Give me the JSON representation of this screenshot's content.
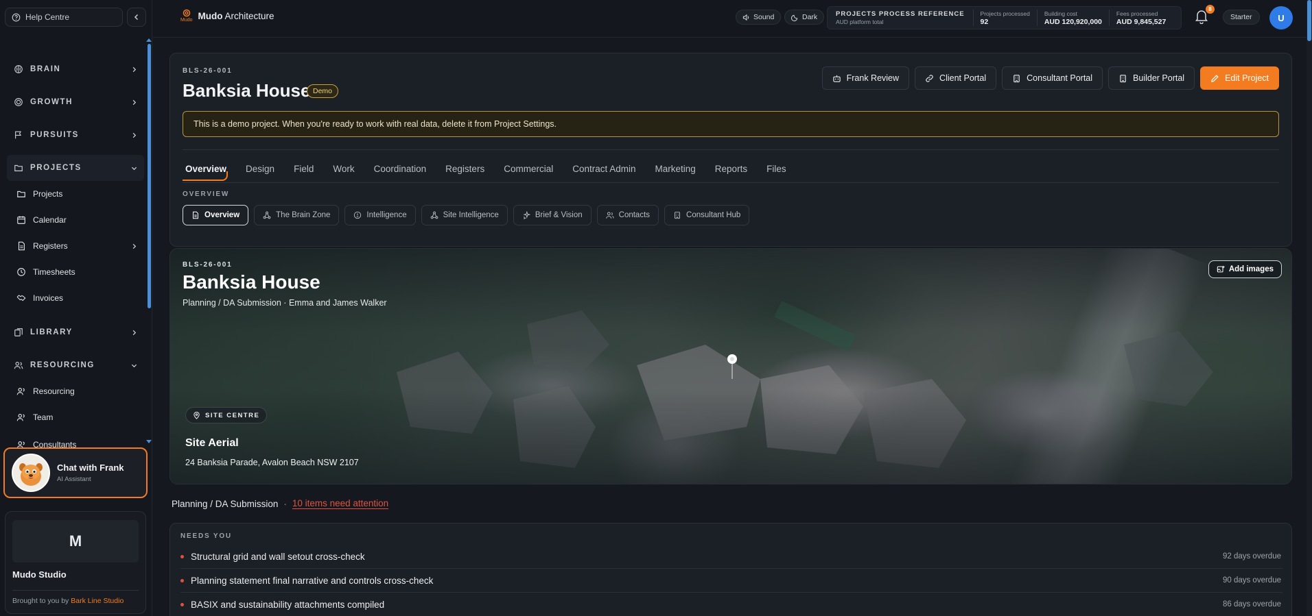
{
  "sidebar": {
    "help_label": "Help Centre",
    "sections": {
      "brain": "BRAIN",
      "growth": "GROWTH",
      "pursuits": "PURSUITS",
      "projects": "PROJECTS",
      "library": "LIBRARY",
      "resourcing": "RESOURCING"
    },
    "projects_items": [
      "Projects",
      "Calendar",
      "Registers",
      "Timesheets",
      "Invoices"
    ],
    "resourcing_items": [
      "Resourcing",
      "Team",
      "Consultants"
    ],
    "chat": {
      "title": "Chat with Frank",
      "subtitle": "AI Assistant"
    },
    "studio": {
      "logo_letter": "M",
      "name": "Mudo Studio",
      "credit_prefix": "Brought to you by",
      "credit_link": "Bark Line Studio"
    }
  },
  "topbar": {
    "brand_mark_label": "Mudo",
    "brand_bold": "Mudo",
    "brand_rest": "Architecture",
    "sound_label": "Sound",
    "theme_label": "Dark",
    "stats_title": "PROJECTS PROCESS REFERENCE",
    "stats_subtitle": "AUD platform total",
    "stats": [
      {
        "label": "Projects processed",
        "value": "92"
      },
      {
        "label": "Building cost",
        "value": "AUD 120,920,000"
      },
      {
        "label": "Fees processed",
        "value": "AUD 9,845,527"
      }
    ],
    "notification_count": "8",
    "plan": "Starter",
    "user_initial": "U"
  },
  "project": {
    "code": "BLS-26-001",
    "title": "Banksia House",
    "badge": "Demo",
    "actions": [
      "Frank Review",
      "Client Portal",
      "Consultant Portal",
      "Builder Portal",
      "Edit Project"
    ],
    "banner": "This is a demo project. When you're ready to work with real data, delete it from Project Settings.",
    "tabs": [
      "Overview",
      "Design",
      "Field",
      "Work",
      "Coordination",
      "Registers",
      "Commercial",
      "Contract Admin",
      "Marketing",
      "Reports",
      "Files"
    ],
    "sub_label": "OVERVIEW",
    "subtabs": [
      "Overview",
      "The Brain Zone",
      "Intelligence",
      "Site Intelligence",
      "Brief & Vision",
      "Contacts",
      "Consultant Hub"
    ]
  },
  "hero": {
    "code": "BLS-26-001",
    "title": "Banksia House",
    "subtitle": "Planning / DA Submission · Emma and James Walker",
    "add_images": "Add images",
    "site_tag": "SITE CENTRE",
    "site_title": "Site Aerial",
    "site_address": "24 Banksia Parade, Avalon Beach NSW 2107"
  },
  "stage": {
    "name": "Planning / DA Submission",
    "separator": "·",
    "attention": "10 items need attention"
  },
  "needs": {
    "label": "NEEDS YOU",
    "items": [
      {
        "text": "Structural grid and wall setout cross-check",
        "due": "92 days overdue"
      },
      {
        "text": "Planning statement final narrative and controls cross-check",
        "due": "90 days overdue"
      },
      {
        "text": "BASIX and sustainability attachments compiled",
        "due": "86 days overdue"
      }
    ]
  },
  "colors": {
    "accent": "#f47c20",
    "alert": "#e0523f",
    "badge_gold": "#c9a23c",
    "avatar_blue": "#2f7be8"
  }
}
